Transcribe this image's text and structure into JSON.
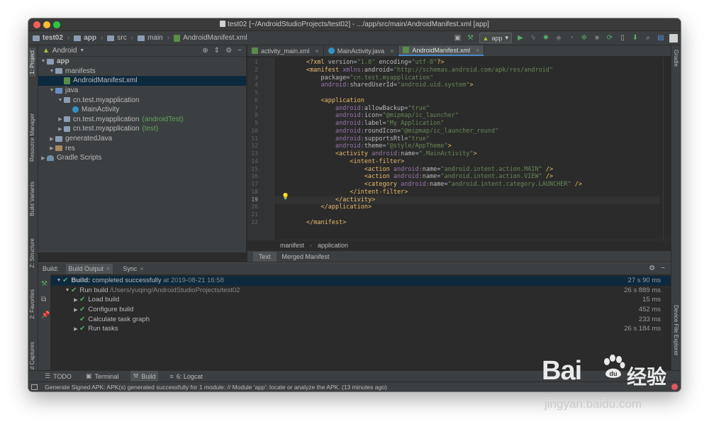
{
  "window": {
    "title": "test02 [~/AndroidStudioProjects/test02] - .../app/src/main/AndroidManifest.xml [app]"
  },
  "navbar": {
    "crumbs": [
      "test02",
      "app",
      "src",
      "main",
      "AndroidManifest.xml"
    ],
    "run_config": "app"
  },
  "left_strip": {
    "labels": [
      "1: Project",
      "Resource Manager",
      "Build Variants",
      "Z: Structure",
      "2: Favorites",
      "Layout Captures"
    ]
  },
  "right_strip": {
    "labels": [
      "Gradle",
      "Device File Explorer"
    ]
  },
  "project_panel": {
    "view": "Android",
    "tree": [
      {
        "label": "app",
        "suffix": "",
        "bold": true
      },
      {
        "label": "manifests",
        "suffix": ""
      },
      {
        "label": "AndroidManifest.xml",
        "suffix": ""
      },
      {
        "label": "java",
        "suffix": ""
      },
      {
        "label": "cn.test.myapplication",
        "suffix": ""
      },
      {
        "label": "MainActivity",
        "suffix": ""
      },
      {
        "label": "cn.test.myapplication",
        "suffix": "(androidTest)"
      },
      {
        "label": "cn.test.myapplication",
        "suffix": "(test)"
      },
      {
        "label": "generatedJava",
        "suffix": ""
      },
      {
        "label": "res",
        "suffix": ""
      },
      {
        "label": "Gradle Scripts",
        "suffix": ""
      }
    ]
  },
  "editor": {
    "tabs": [
      "activity_main.xml",
      "MainActivity.java",
      "AndroidManifest.xml"
    ],
    "active_tab": 2,
    "current_line": 19,
    "lines": [
      "<?xml version=\"1.0\" encoding=\"utf-8\"?>",
      "<manifest xmlns:android=\"http://schemas.android.com/apk/res/android\"",
      "    package=\"cn.test.myapplication\"",
      "    android:sharedUserId=\"android.uid.system\">",
      "",
      "    <application",
      "        android:allowBackup=\"true\"",
      "        android:icon=\"@mipmap/ic_launcher\"",
      "        android:label=\"My Application\"",
      "        android:roundIcon=\"@mipmap/ic_launcher_round\"",
      "        android:supportsRtl=\"true\"",
      "        android:theme=\"@style/AppTheme\">",
      "        <activity android:name=\".MainActivity\">",
      "            <intent-filter>",
      "                <action android:name=\"android.intent.action.MAIN\" />",
      "                <action android:name=\"android.intent.action.VIEW\" />",
      "                <category android:name=\"android.intent.category.LAUNCHER\" />",
      "            </intent-filter>",
      "        </activity>",
      "    </application>",
      "",
      "</manifest>"
    ],
    "breadcrumb": [
      "manifest",
      "application"
    ],
    "bottom_tabs": [
      "Text",
      "Merged Manifest"
    ]
  },
  "build": {
    "label": "Build:",
    "tabs": [
      "Build Output",
      "Sync"
    ],
    "rows": [
      {
        "label": "Build:",
        "text": "completed successfully",
        "extra": "at 2019-08-21 16:58",
        "time": "27 s 90 ms"
      },
      {
        "label": "Run build",
        "text": "",
        "extra": "/Users/yuqing/AndroidStudioProjects/test02",
        "time": "26 s 889 ms"
      },
      {
        "label": "Load build",
        "text": "",
        "extra": "",
        "time": "15 ms"
      },
      {
        "label": "Configure build",
        "text": "",
        "extra": "",
        "time": "452 ms"
      },
      {
        "label": "Calculate task graph",
        "text": "",
        "extra": "",
        "time": "233 ms"
      },
      {
        "label": "Run tasks",
        "text": "",
        "extra": "",
        "time": "26 s 184 ms"
      }
    ]
  },
  "tool_tabs": [
    "TODO",
    "Terminal",
    "Build",
    "6: Logcat"
  ],
  "status": {
    "message": "Generate Signed APK: APK(s) generated successfully for 1 module: // Module 'app': locate or analyze the APK. (13 minutes ago)"
  },
  "watermark": {
    "brand": "Bai",
    "brand_suffix": "经验",
    "url": "jingyan.baidu.com"
  }
}
